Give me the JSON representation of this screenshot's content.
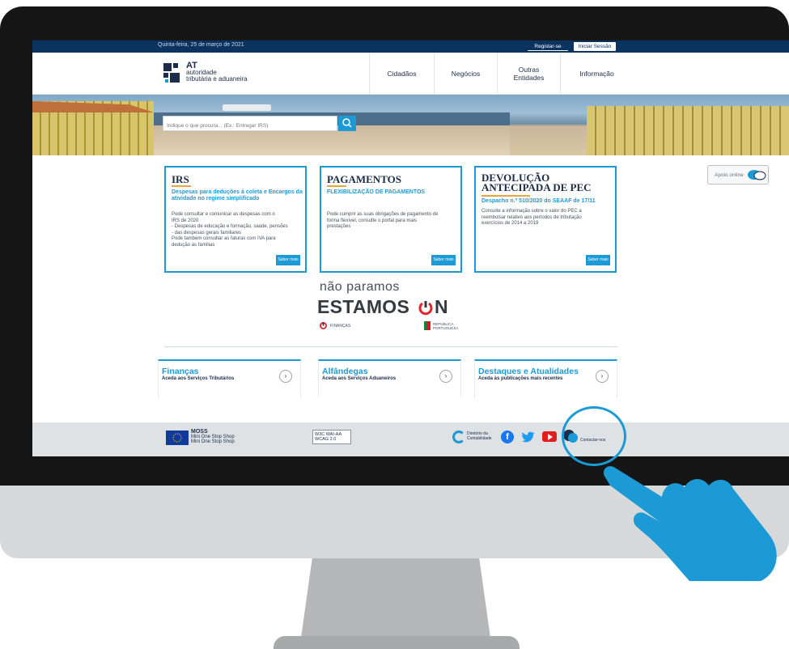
{
  "topbar": {
    "date": "Quinta-feira, 25 de março de 2021",
    "register_label": "Registar-se",
    "login_label": "Iniciar Sessão"
  },
  "header": {
    "logo_short": "AT",
    "logo_line1": "autoridade",
    "logo_line2": "tributária e aduaneira",
    "nav": {
      "cidadaos": "Cidadãos",
      "negocios": "Negócios",
      "outras_line1": "Outras",
      "outras_line2": "Entidades",
      "informacao": "Informação"
    }
  },
  "search": {
    "placeholder": "Indique o que procura... (Ex.: Entregar IRS)",
    "icon": "search-icon"
  },
  "cards": [
    {
      "title": "IRS",
      "subtitle": "Despesas para deduções à coleta e Encargos da atividade no regime simplificado",
      "body_lines": [
        "Pode consultar e comunicar as despesas com o",
        "IRS de 2020",
        "- Despesas de educação e formação, saúde, pensões",
        "- das despesas gerais familiares",
        "Pode também consultar as faturas com IVA para",
        "dedução às famílias"
      ],
      "more": "Saber mais"
    },
    {
      "title": "PAGAMENTOS",
      "subtitle": "FLEXIBILIZAÇÃO DE PAGAMENTOS",
      "body_lines": [
        "Pode cumprir as suas obrigações de pagamento de",
        "forma flexível, consulte o portal para mais",
        "prestações"
      ],
      "more": "Saber mais"
    },
    {
      "title_line1": "DEVOLUÇÃO",
      "title_line2": "ANTECIPADA DE PEC",
      "subtitle": "Despacho n.º 510/2020 do SEAAF de 17/11",
      "body_lines": [
        "Consulte a informação sobre o valor do PEC a",
        "reembolsar relativo aos períodos de tributação",
        "exercícios de 2014 a 2019"
      ],
      "more": "Saber mais"
    }
  ],
  "apoio": {
    "label": "Apoio online"
  },
  "campaign": {
    "line1": "não paramos",
    "line2a": "ESTAMOS",
    "line2b": "N",
    "financas": "FINANÇAS",
    "gov_line1": "REPÚBLICA",
    "gov_line2": "PORTUGUESA"
  },
  "sections": [
    {
      "title": "Finanças",
      "subtitle": "Aceda aos Serviços Tributários",
      "arrow": "›"
    },
    {
      "title": "Alfândegas",
      "subtitle": "Aceda aos Serviços Aduaneiros",
      "arrow": "›"
    },
    {
      "title": "Destaques e Atualidades",
      "subtitle": "Aceda às publicações mais recentes",
      "arrow": "›"
    }
  ],
  "footer": {
    "moss_title": "MOSS",
    "moss_line1": "Mini One Stop Shop",
    "moss_line2": "Mini One Stop Shop",
    "wcag_line1": "WAI-AA",
    "wcag_line2": "WCAG 2.0",
    "wcag_short": "W3C",
    "diretorio_line1": "Diretório da",
    "diretorio_line2": "Contabilidade",
    "twitter_glyph": "🐦",
    "facebook_glyph": "f",
    "contact": "Contactar-nos",
    "colors": {
      "accent": "#1b9ad6",
      "navy": "#0b3360"
    }
  }
}
